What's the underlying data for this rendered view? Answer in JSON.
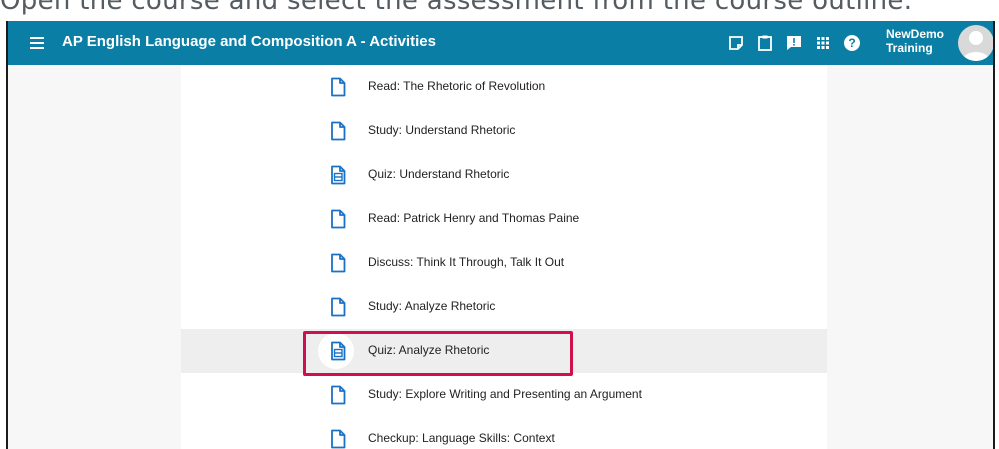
{
  "caption": "Open the course and select the assessment from the course outline.",
  "header": {
    "title": "AP English Language and Composition A - Activities",
    "user_line1": "NewDemo",
    "user_line2": "Training",
    "icons": [
      "notes-icon",
      "clipboard-icon",
      "feedback-icon",
      "apps-grid-icon",
      "help-icon"
    ]
  },
  "activities": [
    {
      "label": "Read: The Rhetoric of Revolution",
      "icon": "document-icon"
    },
    {
      "label": "Study: Understand Rhetoric",
      "icon": "document-icon"
    },
    {
      "label": "Quiz: Understand Rhetoric",
      "icon": "quiz-icon"
    },
    {
      "label": "Read: Patrick Henry and Thomas Paine",
      "icon": "document-icon"
    },
    {
      "label": "Discuss: Think It Through, Talk It Out",
      "icon": "document-icon"
    },
    {
      "label": "Study: Analyze Rhetoric",
      "icon": "document-icon"
    },
    {
      "label": "Quiz: Analyze Rhetoric",
      "icon": "quiz-icon",
      "selected": true
    },
    {
      "label": "Study: Explore Writing and Presenting an Argument",
      "icon": "document-icon"
    },
    {
      "label": "Checkup: Language Skills: Context",
      "icon": "document-icon"
    }
  ],
  "colors": {
    "topbar": "#0a7ea4",
    "icon_blue": "#1a72c7",
    "highlight": "#d0104c"
  }
}
